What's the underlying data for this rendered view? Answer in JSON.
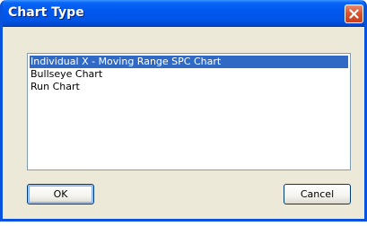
{
  "dialog": {
    "title": "Chart Type",
    "close_icon": "close-icon"
  },
  "list": {
    "items": [
      {
        "label": "Individual X - Moving Range SPC Chart",
        "selected": true
      },
      {
        "label": "Bullseye Chart",
        "selected": false
      },
      {
        "label": "Run Chart",
        "selected": false
      }
    ]
  },
  "buttons": {
    "ok_label": "OK",
    "cancel_label": "Cancel"
  },
  "colors": {
    "titlebar": "#0055e5",
    "selection": "#316ac5",
    "dialog_face": "#ece9d8",
    "close_button": "#e0532b"
  }
}
